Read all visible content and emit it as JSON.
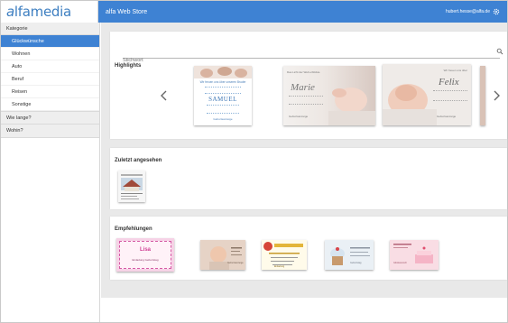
{
  "header": {
    "logo_text": "alfamedia",
    "app_title": "alfa Web Store",
    "user_email": "hubert.hesse@alfa.de"
  },
  "sidebar": {
    "kategorie_label": "Kategorie",
    "items": [
      {
        "label": "Glückwünsche",
        "active": true
      },
      {
        "label": "Wohnen",
        "active": false
      },
      {
        "label": "Auto",
        "active": false
      },
      {
        "label": "Beruf",
        "active": false
      },
      {
        "label": "Reisen",
        "active": false
      },
      {
        "label": "Sonstige",
        "active": false
      }
    ],
    "groups": [
      "Wie lange?",
      "Wohin?"
    ]
  },
  "search": {
    "placeholder": "Stichwort"
  },
  "highlights": {
    "title": "Highlights",
    "cards": [
      {
        "line1": "Wir freuen uns über unseren Bruder",
        "name": "SAMUEL",
        "caption": "Geburtsanzeige"
      },
      {
        "line1": "Das Licht der Welt erblickte",
        "name": "Marie",
        "caption": "Geburtsanzeige"
      },
      {
        "line1": "Wir freuen uns über",
        "name": "Felix",
        "caption": "Geburtsanzeige"
      }
    ]
  },
  "recent": {
    "title": "Zuletzt angesehen"
  },
  "recommendations": {
    "title": "Empfehlungen",
    "items": [
      {
        "name": "Lisa",
        "caption": "Einladung Geburtstag"
      },
      {
        "caption": "Geburtsanzeige"
      },
      {
        "caption": "Einladung"
      },
      {
        "caption": "Geburtstag"
      },
      {
        "caption": "Glückwunsch"
      }
    ]
  },
  "colors": {
    "accent": "#3e82d3",
    "background": "#e9e9e9"
  }
}
